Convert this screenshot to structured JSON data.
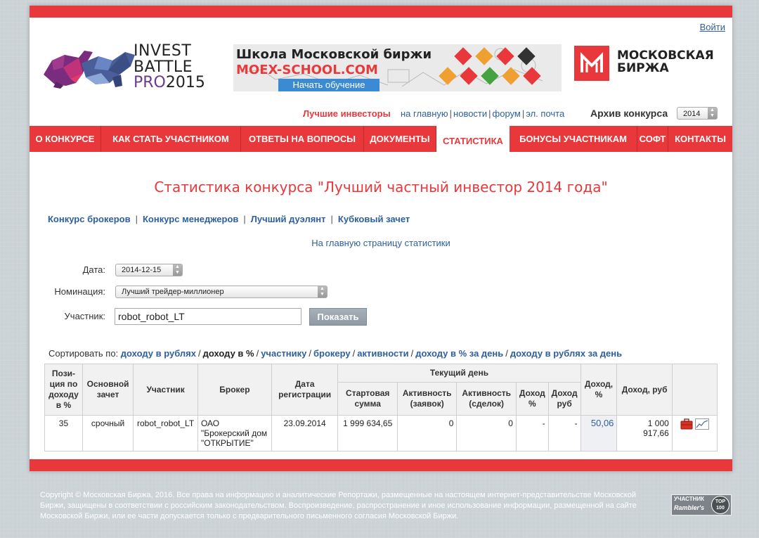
{
  "header": {
    "logout": "Войти",
    "logo": {
      "line1": "INVEST",
      "line2": "BATTLE",
      "pro": "PRO",
      "year": "2015"
    },
    "banner": {
      "title": "Школа Московской биржи",
      "url": "MOEX-SCHOOL.COM",
      "button": "Начать обучение"
    },
    "moex": {
      "line1": "МОСКОВСКАЯ",
      "line2": "БИРЖА"
    }
  },
  "subnav": {
    "best": "Лучшие инвесторы",
    "links": [
      "на главную",
      "новости",
      "форум",
      "эл. почта"
    ],
    "archive_label": "Архив конкурса",
    "archive_year": "2014"
  },
  "mainnav": [
    "О КОНКУРСЕ",
    "КАК СТАТЬ УЧАСТНИКОМ",
    "ОТВЕТЫ НА ВОПРОСЫ",
    "ДОКУМЕНТЫ",
    "СТАТИСТИКА",
    "БОНУСЫ УЧАСТНИКАМ",
    "СОФТ",
    "КОНТАКТЫ"
  ],
  "page": {
    "title": "Статистика конкурса \"Лучший частный инвестор 2014 года\"",
    "tabs": [
      "Конкурс брокеров",
      "Конкурс менеджеров",
      "Лучший дуэлянт",
      "Кубковый зачет"
    ],
    "home_stats": "На главную страницу статистики"
  },
  "filters": {
    "date_label": "Дата:",
    "date_value": "2014-12-15",
    "nomination_label": "Номинация:",
    "nomination_value": "Лучший трейдер-миллионер",
    "participant_label": "Участник:",
    "participant_value": "robot_robot_LT",
    "show_button": "Показать"
  },
  "sort": {
    "label": "Сортировать по:",
    "options": [
      "доходу в рублях",
      "доходу в %",
      "участнику",
      "брокеру",
      "активности",
      "доходу в % за день",
      "доходу в рублях за день"
    ]
  },
  "table": {
    "headers": {
      "position": "Пози-ция по доходу в %",
      "account": "Основной зачет",
      "participant": "Участник",
      "broker": "Брокер",
      "reg_date": "Дата регистрации",
      "current_day": "Текущий день",
      "start_sum": "Стартовая сумма",
      "activity_orders": "Активность (заявок)",
      "activity_deals": "Активность (сделок)",
      "day_pct": "Доход %",
      "day_rub": "Доход руб",
      "income_pct": "Доход, %",
      "income_rub": "Доход, руб"
    },
    "row": {
      "position": "35",
      "account": "срочный",
      "participant": "robot_robot_LT",
      "broker": "ОАО \"Брокерский дом \"ОТКРЫТИЕ\"",
      "reg_date": "23.09.2014",
      "start_sum": "1 999 634,65",
      "activity_orders": "0",
      "activity_deals": "0",
      "day_pct": "-",
      "day_rub": "-",
      "income_pct": "50,06",
      "income_rub": "1 000 917,66"
    }
  },
  "footer": {
    "text": "Copyright © Московская Биржа, 2016. Все права на информацию и аналитические Репортажи, размещенные на настоящем интернет-представительстве Московской Биржи, защищены в соответствии с российским законодательством. Воспроизведение, распространение и иное использование информации, размещенной на сайте Московской Биржи, или ее части допускается только с предварительного письменного согласия Московской Биржи.",
    "counter_line1": "УЧАСТНИК",
    "counter_line2": "Rambler's",
    "counter_top": "TOP 100"
  }
}
